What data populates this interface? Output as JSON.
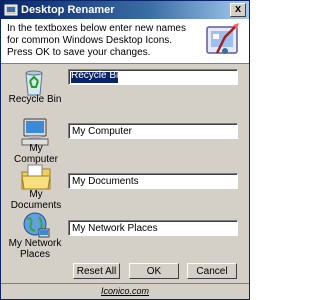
{
  "window": {
    "title": "Desktop Renamer",
    "close_label": "x"
  },
  "header": {
    "instructions": "In the textboxes below enter new names for common Windows Desktop Icons. Press OK to save your changes."
  },
  "items": [
    {
      "label": "Recycle Bin",
      "value": "Recycle Bin",
      "icon": "recycle-bin-icon"
    },
    {
      "label": "My Computer",
      "value": "My Computer",
      "icon": "my-computer-icon"
    },
    {
      "label": "My Documents",
      "value": "My Documents",
      "icon": "my-documents-icon"
    },
    {
      "label": "My Network Places",
      "value": "My Network Places",
      "icon": "my-network-places-icon"
    }
  ],
  "buttons": {
    "reset": "Reset All",
    "ok": "OK",
    "cancel": "Cancel"
  },
  "footer": {
    "link": "Iconico.com"
  }
}
